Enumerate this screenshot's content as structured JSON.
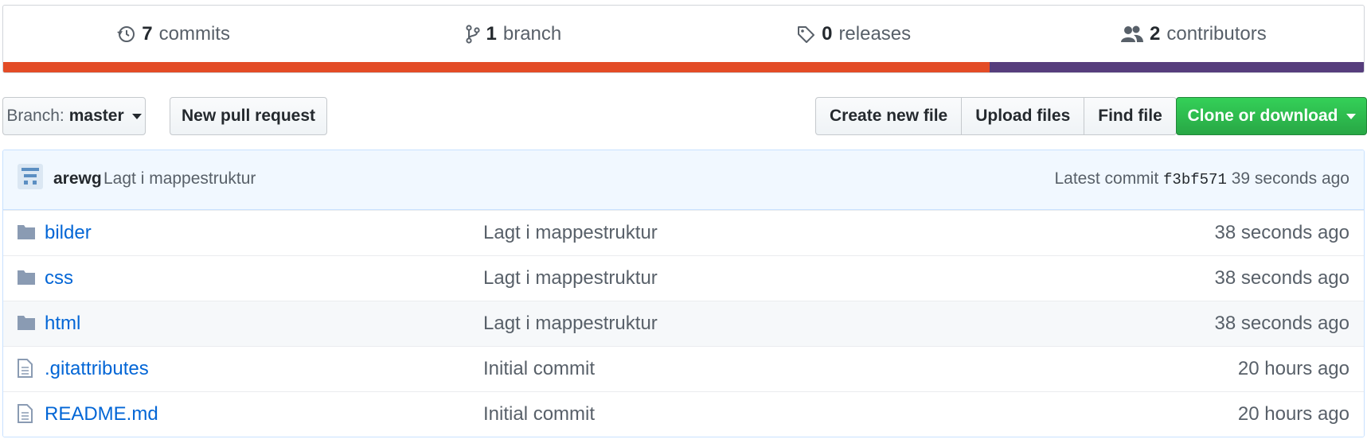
{
  "summary": {
    "commits": {
      "count": "7",
      "label": "commits",
      "icon": "history-icon"
    },
    "branch": {
      "count": "1",
      "label": "branch",
      "icon": "git-branch-icon"
    },
    "releases": {
      "count": "0",
      "label": "releases",
      "icon": "tag-icon"
    },
    "contributors": {
      "count": "2",
      "label": "contributors",
      "icon": "people-icon"
    },
    "languages": [
      {
        "color": "#e34c26",
        "percent": 72.5
      },
      {
        "color": "#563d7c",
        "percent": 27.5
      }
    ]
  },
  "toolbar": {
    "branch_prefix": "Branch:",
    "branch_name": "master",
    "new_pull_request": "New pull request",
    "create_new_file": "Create new file",
    "upload_files": "Upload files",
    "find_file": "Find file",
    "clone_or_download": "Clone or download"
  },
  "latest_commit": {
    "author": "arewg",
    "message": "Lagt i mappestruktur",
    "prefix": "Latest commit",
    "sha": "f3bf571",
    "age": "39 seconds ago"
  },
  "files": [
    {
      "name": "bilder",
      "type": "dir",
      "message": "Lagt i mappestruktur",
      "age": "38 seconds ago"
    },
    {
      "name": "css",
      "type": "dir",
      "message": "Lagt i mappestruktur",
      "age": "38 seconds ago"
    },
    {
      "name": "html",
      "type": "dir",
      "message": "Lagt i mappestruktur",
      "age": "38 seconds ago"
    },
    {
      "name": ".gitattributes",
      "type": "file",
      "message": "Initial commit",
      "age": "20 hours ago"
    },
    {
      "name": "README.md",
      "type": "file",
      "message": "Initial commit",
      "age": "20 hours ago"
    }
  ],
  "colors": {
    "link": "#0366d6",
    "clone_button": "#28a745",
    "commit_tease_bg": "#f1f8ff"
  }
}
